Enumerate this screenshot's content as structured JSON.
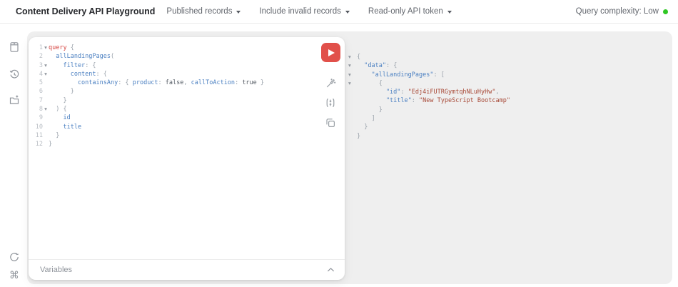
{
  "header": {
    "title": "Content Delivery API Playground",
    "menus": [
      {
        "label": "Published records"
      },
      {
        "label": "Include invalid records"
      },
      {
        "label": "Read-only API token"
      }
    ],
    "complexity": {
      "label": "Query complexity: Low"
    }
  },
  "colors": {
    "panel_bg": "#efefef",
    "run_button": "#e1504a",
    "complexity_dot": "#2fc724",
    "keyword": "#d64541",
    "field": "#4a7fc1",
    "punctuation": "#9aa2ab",
    "boolean": "#545b64",
    "json_key": "#4a7fc1",
    "json_string": "#a84a38"
  },
  "sidebar": {
    "icons": [
      "docs-icon",
      "history-icon",
      "collections-icon",
      "refresh-icon",
      "keyboard-shortcuts-icon"
    ]
  },
  "editor": {
    "lines": [
      {
        "num": "1",
        "fold": true,
        "tokens": [
          [
            "kw",
            "query"
          ],
          [
            "p",
            " {"
          ]
        ]
      },
      {
        "num": "2",
        "fold": false,
        "tokens": [
          [
            "fld",
            "  allLandingPages"
          ],
          [
            "p",
            "("
          ]
        ]
      },
      {
        "num": "3",
        "fold": true,
        "tokens": [
          [
            "fld",
            "    filter"
          ],
          [
            "p",
            ": {"
          ]
        ]
      },
      {
        "num": "4",
        "fold": true,
        "tokens": [
          [
            "fld",
            "      content"
          ],
          [
            "p",
            ": {"
          ]
        ]
      },
      {
        "num": "5",
        "fold": false,
        "tokens": [
          [
            "fld",
            "        containsAny"
          ],
          [
            "p",
            ": { "
          ],
          [
            "fld",
            "product"
          ],
          [
            "p",
            ": "
          ],
          [
            "bool",
            "false"
          ],
          [
            "p",
            ", "
          ],
          [
            "fld",
            "callToAction"
          ],
          [
            "p",
            ": "
          ],
          [
            "bool",
            "true"
          ],
          [
            "p",
            " }"
          ]
        ]
      },
      {
        "num": "6",
        "fold": false,
        "tokens": [
          [
            "p",
            "      }"
          ]
        ]
      },
      {
        "num": "7",
        "fold": false,
        "tokens": [
          [
            "p",
            "    }"
          ]
        ]
      },
      {
        "num": "8",
        "fold": true,
        "tokens": [
          [
            "p",
            "  ) {"
          ]
        ]
      },
      {
        "num": "9",
        "fold": false,
        "tokens": [
          [
            "fld",
            "    id"
          ]
        ]
      },
      {
        "num": "10",
        "fold": false,
        "tokens": [
          [
            "fld",
            "    title"
          ]
        ]
      },
      {
        "num": "11",
        "fold": false,
        "tokens": [
          [
            "p",
            "  }"
          ]
        ]
      },
      {
        "num": "12",
        "fold": false,
        "tokens": [
          [
            "p",
            "}"
          ]
        ]
      }
    ],
    "variables_label": "Variables"
  },
  "toolbar": {
    "run": "run-query",
    "icons": [
      "prettify-icon",
      "merge-icon",
      "copy-icon"
    ]
  },
  "response": {
    "lines": [
      {
        "fold": true,
        "tokens": [
          [
            "p",
            "{"
          ]
        ]
      },
      {
        "fold": true,
        "tokens": [
          [
            "key",
            "  \"data\""
          ],
          [
            "p",
            ": {"
          ]
        ]
      },
      {
        "fold": true,
        "tokens": [
          [
            "key",
            "    \"allLandingPages\""
          ],
          [
            "p",
            ": ["
          ]
        ]
      },
      {
        "fold": true,
        "tokens": [
          [
            "p",
            "      {"
          ]
        ]
      },
      {
        "fold": false,
        "tokens": [
          [
            "key",
            "        \"id\""
          ],
          [
            "p",
            ": "
          ],
          [
            "str",
            "\"Edj4iFUTRGymtqhNLuHyHw\""
          ],
          [
            "p",
            ","
          ]
        ]
      },
      {
        "fold": false,
        "tokens": [
          [
            "key",
            "        \"title\""
          ],
          [
            "p",
            ": "
          ],
          [
            "str",
            "\"New TypeScript Bootcamp\""
          ]
        ]
      },
      {
        "fold": false,
        "tokens": [
          [
            "p",
            "      }"
          ]
        ]
      },
      {
        "fold": false,
        "tokens": [
          [
            "p",
            "    ]"
          ]
        ]
      },
      {
        "fold": false,
        "tokens": [
          [
            "p",
            "  }"
          ]
        ]
      },
      {
        "fold": false,
        "tokens": [
          [
            "p",
            "}"
          ]
        ]
      }
    ]
  }
}
